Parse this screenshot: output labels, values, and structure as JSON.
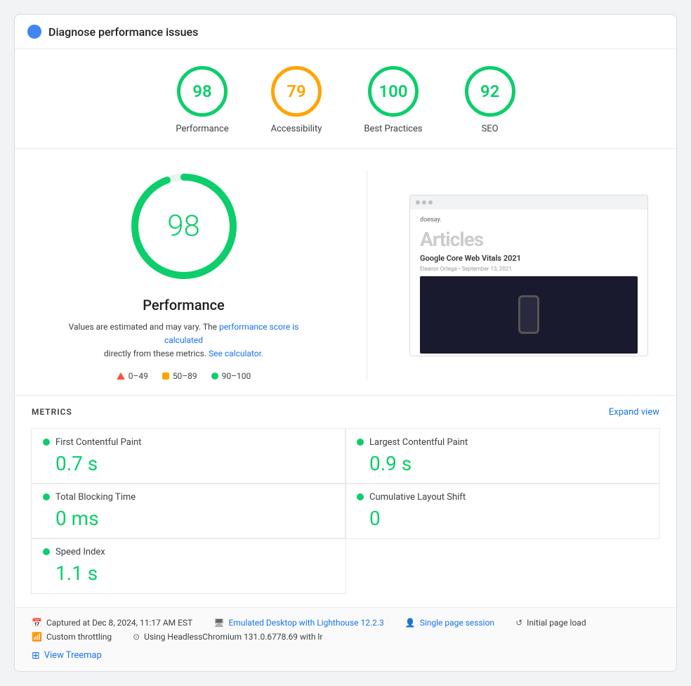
{
  "header": {
    "title": "Diagnose performance issues"
  },
  "scores": [
    {
      "id": "performance",
      "value": "98",
      "label": "Performance",
      "color": "green"
    },
    {
      "id": "accessibility",
      "value": "79",
      "label": "Accessibility",
      "color": "orange"
    },
    {
      "id": "best-practices",
      "value": "100",
      "label": "Best Practices",
      "color": "green"
    },
    {
      "id": "seo",
      "value": "92",
      "label": "SEO",
      "color": "green"
    }
  ],
  "main": {
    "big_score": "98",
    "perf_title": "Performance",
    "perf_desc_1": "Values are estimated and may vary. The",
    "perf_link_1": "performance score is calculated",
    "perf_desc_2": "directly from these metrics.",
    "perf_link_2": "See calculator.",
    "legend": [
      {
        "type": "triangle",
        "range": "0–49"
      },
      {
        "type": "square",
        "range": "50–89"
      },
      {
        "type": "dot",
        "range": "90–100"
      }
    ]
  },
  "screenshot": {
    "site": "doesay.",
    "section": "Articles",
    "article_title": "Google Core Web Vitals 2021",
    "meta": "Eleanor Ortega • September 13, 2021"
  },
  "metrics": {
    "section_title": "METRICS",
    "expand_label": "Expand view",
    "items": [
      {
        "name": "First Contentful Paint",
        "value": "0.7 s",
        "col": 0,
        "row": 0
      },
      {
        "name": "Largest Contentful Paint",
        "value": "0.9 s",
        "col": 1,
        "row": 0
      },
      {
        "name": "Total Blocking Time",
        "value": "0 ms",
        "col": 0,
        "row": 1
      },
      {
        "name": "Cumulative Layout Shift",
        "value": "0",
        "col": 1,
        "row": 1
      },
      {
        "name": "Speed Index",
        "value": "1.1 s",
        "col": 0,
        "row": 2
      }
    ]
  },
  "footer": {
    "captured": "Captured at Dec 8, 2024, 11:17 AM EST",
    "initial_load": "Initial page load",
    "device": "Emulated Desktop with Lighthouse 12.2.3",
    "throttling": "Custom throttling",
    "session": "Single page session",
    "browser": "Using HeadlessChromium 131.0.6778.69 with lr",
    "view_treemap": "View Treemap"
  }
}
